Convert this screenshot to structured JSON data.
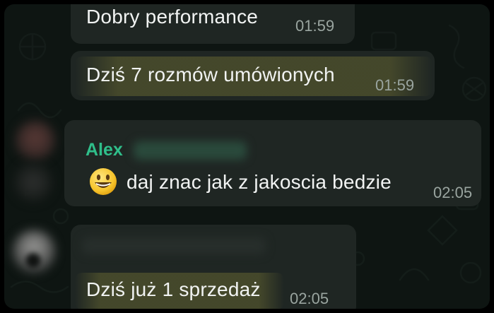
{
  "messages": [
    {
      "text": "Dobry performance",
      "time": "01:59",
      "highlighted": false
    },
    {
      "text": "Dziś 7 rozmów umówionych",
      "time": "01:59",
      "highlighted": true
    },
    {
      "sender": "Alex",
      "emoji": "smiley-emoji",
      "text": "daj znac jak z jakoscia bedzie",
      "time": "02:05",
      "highlighted": false
    },
    {
      "text": "Dziś już 1 sprzedaż",
      "time": "02:05",
      "highlighted": true
    }
  ],
  "colors": {
    "background": "#0e1512",
    "bubble": "#1f2623",
    "sender_name": "#2fbe8a",
    "timestamp": "#9aa5a0",
    "highlight": "#c8be46"
  }
}
